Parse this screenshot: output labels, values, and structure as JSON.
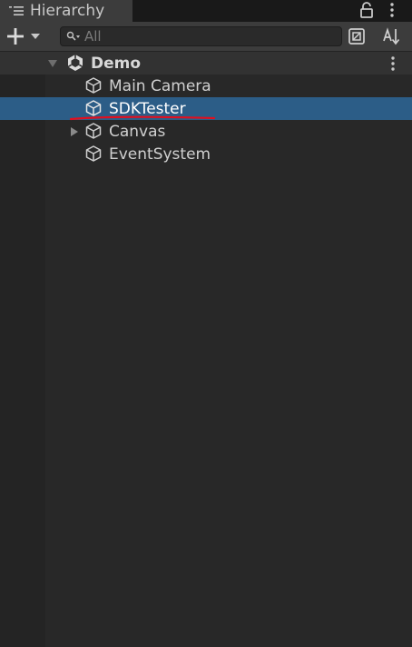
{
  "window": {
    "tab_title": "Hierarchy",
    "tab_icon": "list-icon",
    "lock_icon": "lock-icon",
    "menu_icon": "kebab-menu-icon"
  },
  "toolbar": {
    "add_icon": "plus-icon",
    "dropdown_icon": "caret-down-icon",
    "search": {
      "icon": "search-icon",
      "placeholder": "All",
      "value": ""
    },
    "scene_visibility_icon": "scene-visibility-icon",
    "sort_icon": "sort-icon"
  },
  "hierarchy": {
    "scene": {
      "name": "Demo",
      "expanded": true,
      "icon": "unity-logo-icon",
      "menu_icon": "kebab-menu-icon"
    },
    "items": [
      {
        "name": "Main Camera",
        "icon": "cube-icon",
        "has_children": false,
        "selected": false
      },
      {
        "name": "SDKTester",
        "icon": "cube-icon",
        "has_children": false,
        "selected": true,
        "annotation": "red-underline"
      },
      {
        "name": "Canvas",
        "icon": "cube-icon",
        "has_children": true,
        "expanded": false,
        "selected": false
      },
      {
        "name": "EventSystem",
        "icon": "cube-icon",
        "has_children": false,
        "selected": false
      }
    ]
  },
  "colors": {
    "selection": "#2c5d87",
    "annotation": "#e01020",
    "background": "#282828"
  }
}
